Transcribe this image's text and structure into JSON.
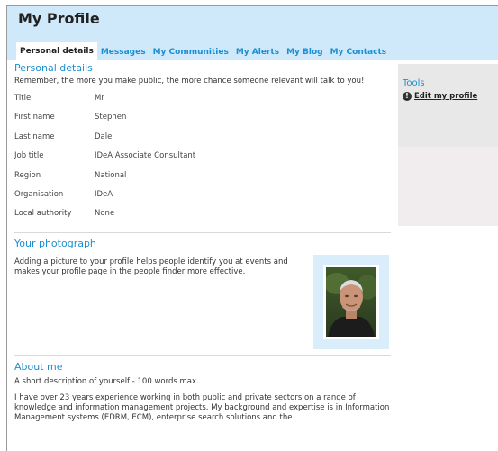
{
  "header": {
    "title": "My Profile",
    "tabs": [
      {
        "label": "Personal details",
        "active": true
      },
      {
        "label": "Messages"
      },
      {
        "label": "My Communities"
      },
      {
        "label": "My Alerts"
      },
      {
        "label": "My Blog"
      },
      {
        "label": "My Contacts"
      }
    ]
  },
  "personal": {
    "title": "Personal details",
    "intro": "Remember, the more you make public, the more chance someone relevant will talk to you!",
    "fields": [
      {
        "label": "Title",
        "value": "Mr"
      },
      {
        "label": "First name",
        "value": "Stephen"
      },
      {
        "label": "Last name",
        "value": "Dale"
      },
      {
        "label": "Job title",
        "value": "IDeA Associate Consultant"
      },
      {
        "label": "Region",
        "value": "National"
      },
      {
        "label": "Organisation",
        "value": "IDeA"
      },
      {
        "label": "Local authority",
        "value": "None"
      }
    ]
  },
  "photo": {
    "title": "Your photograph",
    "text": "Adding a picture to your profile helps people identify you at events and makes your profile page in the people finder more effective."
  },
  "about": {
    "title": "About me",
    "hint": "A short description of yourself - 100 words max.",
    "text": "I have over 23 years experience working in both public and private sectors on a range of knowledge and information management projects. My background and expertise is in Information Management systems (EDRM, ECM), enterprise search solutions and the"
  },
  "sidebar": {
    "tools_title": "Tools",
    "edit_label": "Edit my profile",
    "edit_icon": "!"
  },
  "colors": {
    "header_bg": "#cfe9fa",
    "accent": "#1a8fd1",
    "sidebar_bg": "#e8e8e8",
    "sidebar_lower_bg": "#f1ecee"
  }
}
